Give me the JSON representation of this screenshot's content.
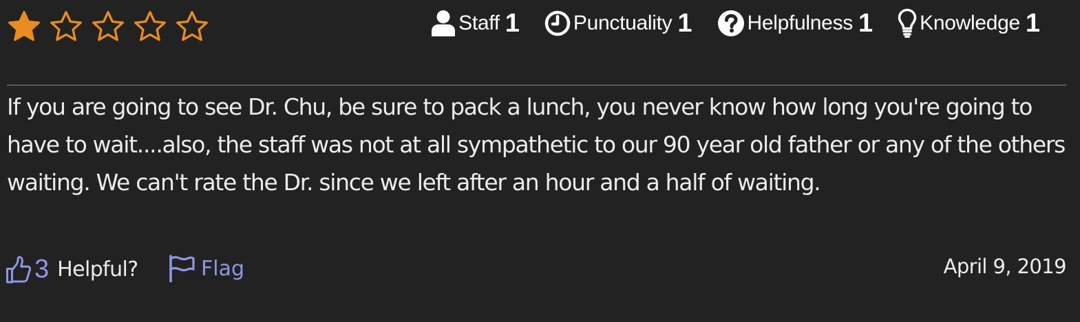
{
  "review": {
    "rating": 1,
    "rating_max": 5,
    "colors": {
      "star": "#e88d1d",
      "accent": "#8c98e6",
      "background": "#222222",
      "text": "#ececec"
    },
    "metrics": [
      {
        "icon": "user-icon",
        "label": "Staff",
        "value": "1"
      },
      {
        "icon": "clock-icon",
        "label": "Punctuality",
        "value": "1"
      },
      {
        "icon": "question-circle-icon",
        "label": "Helpfulness",
        "value": "1"
      },
      {
        "icon": "lightbulb-icon",
        "label": "Knowledge",
        "value": "1"
      }
    ],
    "text": "If you are going to see Dr. Chu, be sure to pack a lunch, you never know how long you're going to have to wait....also, the staff was not at all sympathetic to our 90 year old father or any of the others waiting. We can't rate the Dr. since we left after an hour and a half of waiting.",
    "helpful": {
      "icon": "thumbs-up-icon",
      "count": "3",
      "label": "Helpful?"
    },
    "flag": {
      "icon": "flag-icon",
      "label": "Flag"
    },
    "date": "April 9, 2019"
  }
}
